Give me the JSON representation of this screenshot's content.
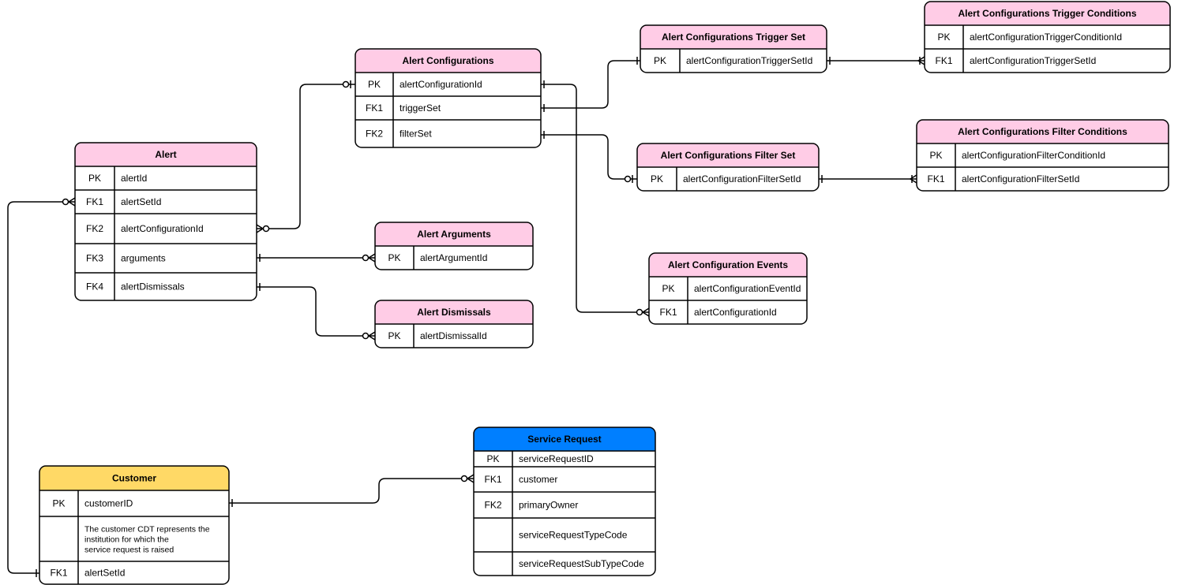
{
  "colors": {
    "pink": "#FFCCE6",
    "yellow": "#FFD966",
    "blue": "#007FFF",
    "line": "#000000"
  },
  "entities": [
    {
      "id": "alert",
      "title": "Alert",
      "color": "pink",
      "rows": [
        {
          "key": "PK",
          "name": "alertId"
        },
        {
          "key": "FK1",
          "name": "alertSetId"
        },
        {
          "key": "FK2",
          "name": "alertConfigurationId"
        },
        {
          "key": "FK3",
          "name": "arguments"
        },
        {
          "key": "FK4",
          "name": "alertDismissals"
        }
      ]
    },
    {
      "id": "alert-configurations",
      "title": "Alert Configurations",
      "color": "pink",
      "rows": [
        {
          "key": "PK",
          "name": "alertConfigurationId"
        },
        {
          "key": "FK1",
          "name": "triggerSet"
        },
        {
          "key": "FK2",
          "name": "filterSet"
        }
      ]
    },
    {
      "id": "trigger-set",
      "title": "Alert Configurations Trigger Set",
      "color": "pink",
      "rows": [
        {
          "key": "PK",
          "name": "alertConfigurationTriggerSetId"
        }
      ]
    },
    {
      "id": "trigger-conditions",
      "title": "Alert Configurations Trigger Conditions",
      "color": "pink",
      "rows": [
        {
          "key": "PK",
          "name": "alertConfigurationTriggerConditionId"
        },
        {
          "key": "FK1",
          "name": "alertConfigurationTriggerSetId"
        }
      ]
    },
    {
      "id": "filter-set",
      "title": "Alert Configurations Filter Set",
      "color": "pink",
      "rows": [
        {
          "key": "PK",
          "name": "alertConfigurationFilterSetId"
        }
      ]
    },
    {
      "id": "filter-conditions",
      "title": "Alert Configurations Filter Conditions",
      "color": "pink",
      "rows": [
        {
          "key": "PK",
          "name": "alertConfigurationFilterConditionId"
        },
        {
          "key": "FK1",
          "name": "alertConfigurationFilterSetId"
        }
      ]
    },
    {
      "id": "alert-arguments",
      "title": "Alert Arguments",
      "color": "pink",
      "rows": [
        {
          "key": "PK",
          "name": "alertArgumentId"
        }
      ]
    },
    {
      "id": "alert-dismissals",
      "title": "Alert Dismissals",
      "color": "pink",
      "rows": [
        {
          "key": "PK",
          "name": "alertDismissalId"
        }
      ]
    },
    {
      "id": "alert-configuration-events",
      "title": "Alert Configuration Events",
      "color": "pink",
      "rows": [
        {
          "key": "PK",
          "name": "alertConfigurationEventId"
        },
        {
          "key": "FK1",
          "name": "alertConfigurationId"
        }
      ]
    },
    {
      "id": "service-request",
      "title": "Service Request",
      "color": "blue",
      "rows": [
        {
          "key": "PK",
          "name": "serviceRequestID"
        },
        {
          "key": "FK1",
          "name": "customer"
        },
        {
          "key": "FK2",
          "name": "primaryOwner"
        },
        {
          "key": "",
          "name": "serviceRequestTypeCode"
        },
        {
          "key": "",
          "name": "serviceRequestSubTypeCode"
        }
      ]
    },
    {
      "id": "customer",
      "title": "Customer",
      "color": "yellow",
      "rows": [
        {
          "key": "PK",
          "name": "customerID"
        },
        {
          "key": "",
          "name": "The customer CDT represents the institution for which the service request is raised"
        },
        {
          "key": "FK1",
          "name": "alertSetId"
        }
      ]
    }
  ],
  "relationships": [
    {
      "from": "alert.alertSetId",
      "to": "customer.alertSetId",
      "from_card": "zero-or-many",
      "to_card": "one"
    },
    {
      "from": "alert.alertConfigurationId",
      "to": "alert-configurations.alertConfigurationId",
      "from_card": "zero-or-many",
      "to_card": "zero-or-one"
    },
    {
      "from": "alert.arguments",
      "to": "alert-arguments.alertArgumentId",
      "from_card": "one",
      "to_card": "zero-or-many"
    },
    {
      "from": "alert.alertDismissals",
      "to": "alert-dismissals.alertDismissalId",
      "from_card": "one",
      "to_card": "zero-or-many"
    },
    {
      "from": "alert-configurations.alertConfigurationId",
      "to": "alert-configuration-events.alertConfigurationId",
      "from_card": "one",
      "to_card": "zero-or-many"
    },
    {
      "from": "alert-configurations.triggerSet",
      "to": "trigger-set.alertConfigurationTriggerSetId",
      "from_card": "one",
      "to_card": "one"
    },
    {
      "from": "alert-configurations.filterSet",
      "to": "filter-set.alertConfigurationFilterSetId",
      "from_card": "one",
      "to_card": "zero-or-one"
    },
    {
      "from": "trigger-set.alertConfigurationTriggerSetId",
      "to": "trigger-conditions.alertConfigurationTriggerSetId",
      "from_card": "one",
      "to_card": "one-or-many"
    },
    {
      "from": "filter-set.alertConfigurationFilterSetId",
      "to": "filter-conditions.alertConfigurationFilterSetId",
      "from_card": "one",
      "to_card": "one-or-many"
    },
    {
      "from": "customer.customerID",
      "to": "service-request.customer",
      "from_card": "one",
      "to_card": "zero-or-many"
    }
  ]
}
